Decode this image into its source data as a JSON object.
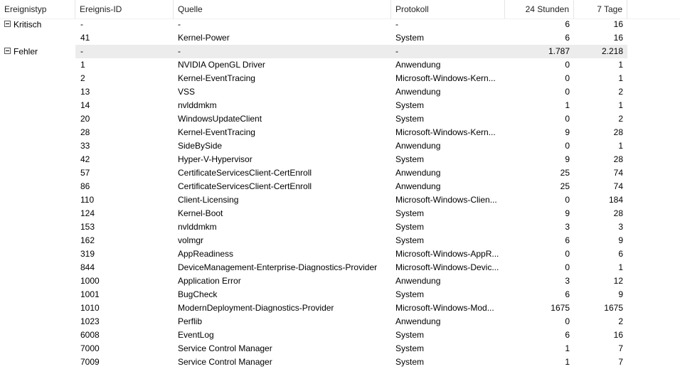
{
  "columns": {
    "type": "Ereignistyp",
    "id": "Ereignis-ID",
    "source": "Quelle",
    "protocol": "Protokoll",
    "h24": "24 Stunden",
    "d7": "7 Tage"
  },
  "rows": [
    {
      "group": true,
      "type": "Kritisch",
      "id": "-",
      "source": "-",
      "protocol": "-",
      "h24": "6",
      "d7": "16",
      "shaded": false
    },
    {
      "id": "41",
      "source": "Kernel-Power",
      "protocol": "System",
      "h24": "6",
      "d7": "16"
    },
    {
      "group": true,
      "type": "Fehler",
      "id": "-",
      "source": "-",
      "protocol": "-",
      "h24": "1.787",
      "d7": "2.218",
      "shaded": true
    },
    {
      "id": "1",
      "source": "NVIDIA OpenGL Driver",
      "protocol": "Anwendung",
      "h24": "0",
      "d7": "1"
    },
    {
      "id": "2",
      "source": "Kernel-EventTracing",
      "protocol": "Microsoft-Windows-Kern...",
      "h24": "0",
      "d7": "1"
    },
    {
      "id": "13",
      "source": "VSS",
      "protocol": "Anwendung",
      "h24": "0",
      "d7": "2"
    },
    {
      "id": "14",
      "source": "nvlddmkm",
      "protocol": "System",
      "h24": "1",
      "d7": "1"
    },
    {
      "id": "20",
      "source": "WindowsUpdateClient",
      "protocol": "System",
      "h24": "0",
      "d7": "2"
    },
    {
      "id": "28",
      "source": "Kernel-EventTracing",
      "protocol": "Microsoft-Windows-Kern...",
      "h24": "9",
      "d7": "28"
    },
    {
      "id": "33",
      "source": "SideBySide",
      "protocol": "Anwendung",
      "h24": "0",
      "d7": "1"
    },
    {
      "id": "42",
      "source": "Hyper-V-Hypervisor",
      "protocol": "System",
      "h24": "9",
      "d7": "28"
    },
    {
      "id": "57",
      "source": "CertificateServicesClient-CertEnroll",
      "protocol": "Anwendung",
      "h24": "25",
      "d7": "74"
    },
    {
      "id": "86",
      "source": "CertificateServicesClient-CertEnroll",
      "protocol": "Anwendung",
      "h24": "25",
      "d7": "74"
    },
    {
      "id": "110",
      "source": "Client-Licensing",
      "protocol": "Microsoft-Windows-Clien...",
      "h24": "0",
      "d7": "184"
    },
    {
      "id": "124",
      "source": "Kernel-Boot",
      "protocol": "System",
      "h24": "9",
      "d7": "28"
    },
    {
      "id": "153",
      "source": "nvlddmkm",
      "protocol": "System",
      "h24": "3",
      "d7": "3"
    },
    {
      "id": "162",
      "source": "volmgr",
      "protocol": "System",
      "h24": "6",
      "d7": "9"
    },
    {
      "id": "319",
      "source": "AppReadiness",
      "protocol": "Microsoft-Windows-AppR...",
      "h24": "0",
      "d7": "6"
    },
    {
      "id": "844",
      "source": "DeviceManagement-Enterprise-Diagnostics-Provider",
      "protocol": "Microsoft-Windows-Devic...",
      "h24": "0",
      "d7": "1"
    },
    {
      "id": "1000",
      "source": "Application Error",
      "protocol": "Anwendung",
      "h24": "3",
      "d7": "12"
    },
    {
      "id": "1001",
      "source": "BugCheck",
      "protocol": "System",
      "h24": "6",
      "d7": "9"
    },
    {
      "id": "1010",
      "source": "ModernDeployment-Diagnostics-Provider",
      "protocol": "Microsoft-Windows-Mod...",
      "h24": "1675",
      "d7": "1675"
    },
    {
      "id": "1023",
      "source": "Perflib",
      "protocol": "Anwendung",
      "h24": "0",
      "d7": "2"
    },
    {
      "id": "6008",
      "source": "EventLog",
      "protocol": "System",
      "h24": "6",
      "d7": "16"
    },
    {
      "id": "7000",
      "source": "Service Control Manager",
      "protocol": "System",
      "h24": "1",
      "d7": "7"
    },
    {
      "id": "7009",
      "source": "Service Control Manager",
      "protocol": "System",
      "h24": "1",
      "d7": "7"
    }
  ]
}
